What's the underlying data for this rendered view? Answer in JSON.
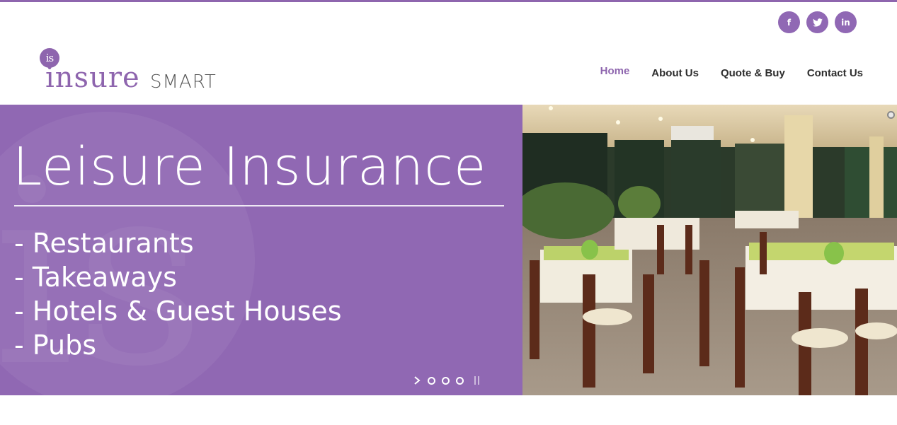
{
  "brand": {
    "logo_mark": "is",
    "logo_word1": "insure",
    "logo_word2": "SMART"
  },
  "social": [
    {
      "label": "f",
      "icon": "facebook-icon"
    },
    {
      "label": "twitter",
      "icon": "twitter-icon"
    },
    {
      "label": "in",
      "icon": "linkedin-icon"
    }
  ],
  "nav": {
    "items": [
      {
        "label": "Home",
        "active": true
      },
      {
        "label": "About Us",
        "active": false
      },
      {
        "label": "Quote & Buy",
        "active": false
      },
      {
        "label": "Contact Us",
        "active": false
      }
    ]
  },
  "hero": {
    "title": "Leisure Insurance",
    "list": [
      "- Restaurants",
      "- Takeaways",
      "- Hotels & Guest Houses",
      "- Pubs"
    ],
    "slide_count": 3,
    "image_alt_icon": "restaurant-photo"
  },
  "colors": {
    "accent": "#8e65ae",
    "hero_bg": "#9068b3",
    "nav_text": "#2d2d2d"
  }
}
